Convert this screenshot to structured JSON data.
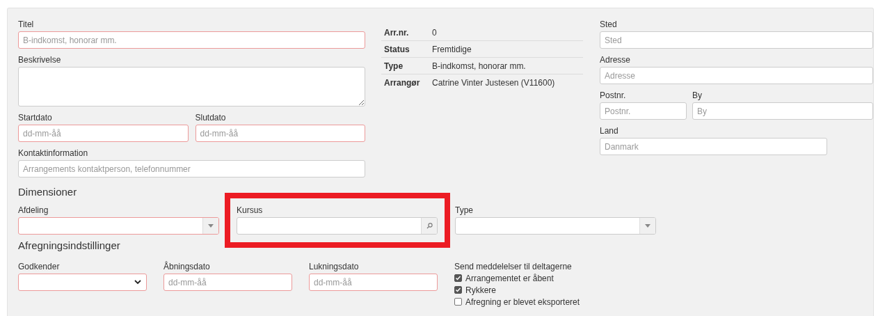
{
  "title_field": {
    "label": "Titel",
    "placeholder": "B-indkomst, honorar mm.",
    "required": true
  },
  "description_field": {
    "label": "Beskrivelse",
    "required": false
  },
  "dates": [
    {
      "label": "Startdato",
      "placeholder": "dd-mm-åå",
      "required": true
    },
    {
      "label": "Slutdato",
      "placeholder": "dd-mm-åå",
      "required": true
    }
  ],
  "contact_field": {
    "label": "Kontaktinformation",
    "placeholder": "Arrangements kontaktperson, telefonnummer",
    "required": false
  },
  "info": [
    {
      "label": "Arr.nr.",
      "value": "0"
    },
    {
      "label": "Status",
      "value": "Fremtidige"
    },
    {
      "label": "Type",
      "value": "B-indkomst, honorar mm."
    },
    {
      "label": "Arrangør",
      "value": "Catrine Vinter Justesen (V11600)"
    }
  ],
  "location": {
    "place": {
      "label": "Sted",
      "placeholder": "Sted",
      "required": false
    },
    "address": {
      "label": "Adresse",
      "placeholder": "Adresse",
      "required": false
    },
    "postal": {
      "label": "Postnr.",
      "placeholder": "Postnr.",
      "required": false
    },
    "city": {
      "label": "By",
      "placeholder": "By",
      "required": false
    },
    "country": {
      "label": "Land",
      "placeholder": "Danmark",
      "required": false
    }
  },
  "dimensions": {
    "heading": "Dimensioner",
    "fields": [
      {
        "label": "Afdeling",
        "kind": "dropdown",
        "required": true,
        "highlighted": false
      },
      {
        "label": "Kursus",
        "kind": "lookup",
        "required": false,
        "highlighted": true
      },
      {
        "label": "Type",
        "kind": "dropdown",
        "required": false,
        "highlighted": false
      }
    ]
  },
  "settlement": {
    "heading": "Afregningsindstillinger",
    "fields": [
      {
        "label": "Godkender",
        "kind": "select",
        "required": true
      },
      {
        "label": "Åbningsdato",
        "kind": "date",
        "placeholder": "dd-mm-åå",
        "required": true
      },
      {
        "label": "Lukningsdato",
        "kind": "date",
        "placeholder": "dd-mm-åå",
        "required": true
      }
    ],
    "notifications": {
      "label": "Send meddelelser til deltagerne",
      "options": [
        {
          "label": "Arrangementet er åbent",
          "checked": true
        },
        {
          "label": "Rykkere",
          "checked": true
        },
        {
          "label": "Afregning er blevet eksporteret",
          "checked": false
        }
      ]
    }
  }
}
